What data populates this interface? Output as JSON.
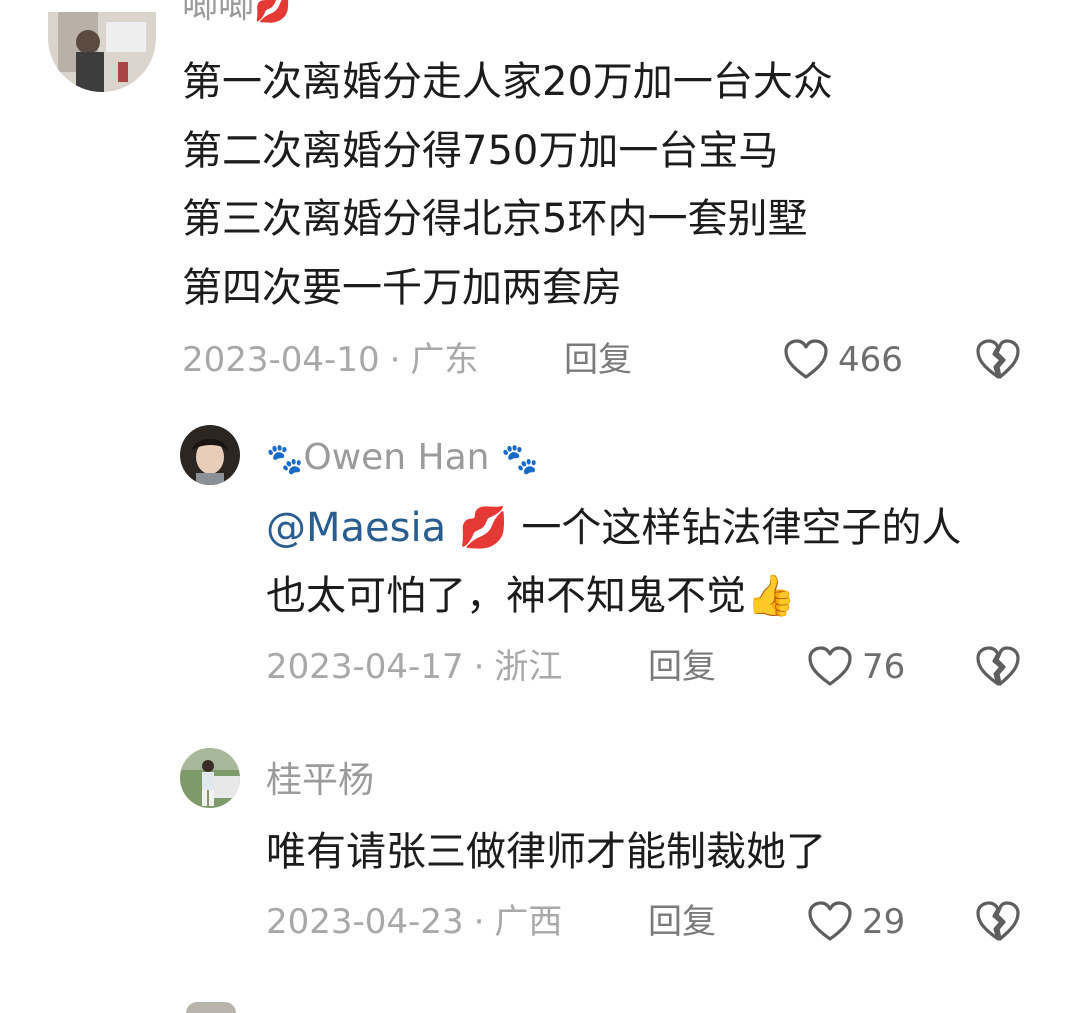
{
  "comments": [
    {
      "name": "唧唧",
      "name_emoji": "💋",
      "lines": [
        "第一次离婚分走人家20万加一台大众",
        "第二次离婚分得750万加一台宝马",
        "第三次离婚分得北京5环内一套别墅",
        "第四次要一千万加两套房"
      ],
      "date": "2023-04-10",
      "dot": "·",
      "location": "广东",
      "reply_label": "回复",
      "likes": "466"
    },
    {
      "name_prefix": "🐾",
      "name": "Owen Han",
      "name_suffix": "🐾",
      "mention": "@Maesia",
      "mention_emoji": "💋",
      "line1_rest": " 一个这样钻法律空子的人",
      "line2": "也太可怕了，神不知鬼不觉",
      "line2_emoji": "👍",
      "date": "2023-04-17",
      "dot": "·",
      "location": "浙江",
      "reply_label": "回复",
      "likes": "76"
    },
    {
      "name": "桂平杨",
      "line1": "唯有请张三做律师才能制裁她了",
      "date": "2023-04-23",
      "dot": "·",
      "location": "广西",
      "reply_label": "回复",
      "likes": "29"
    }
  ],
  "icons": {
    "like": "heart-outline-icon",
    "dislike": "broken-heart-icon"
  },
  "colors": {
    "text": "#1c1c1c",
    "meta": "#a8a8a8",
    "mention": "#2a5d8f",
    "icon": "#5e5e5e"
  }
}
